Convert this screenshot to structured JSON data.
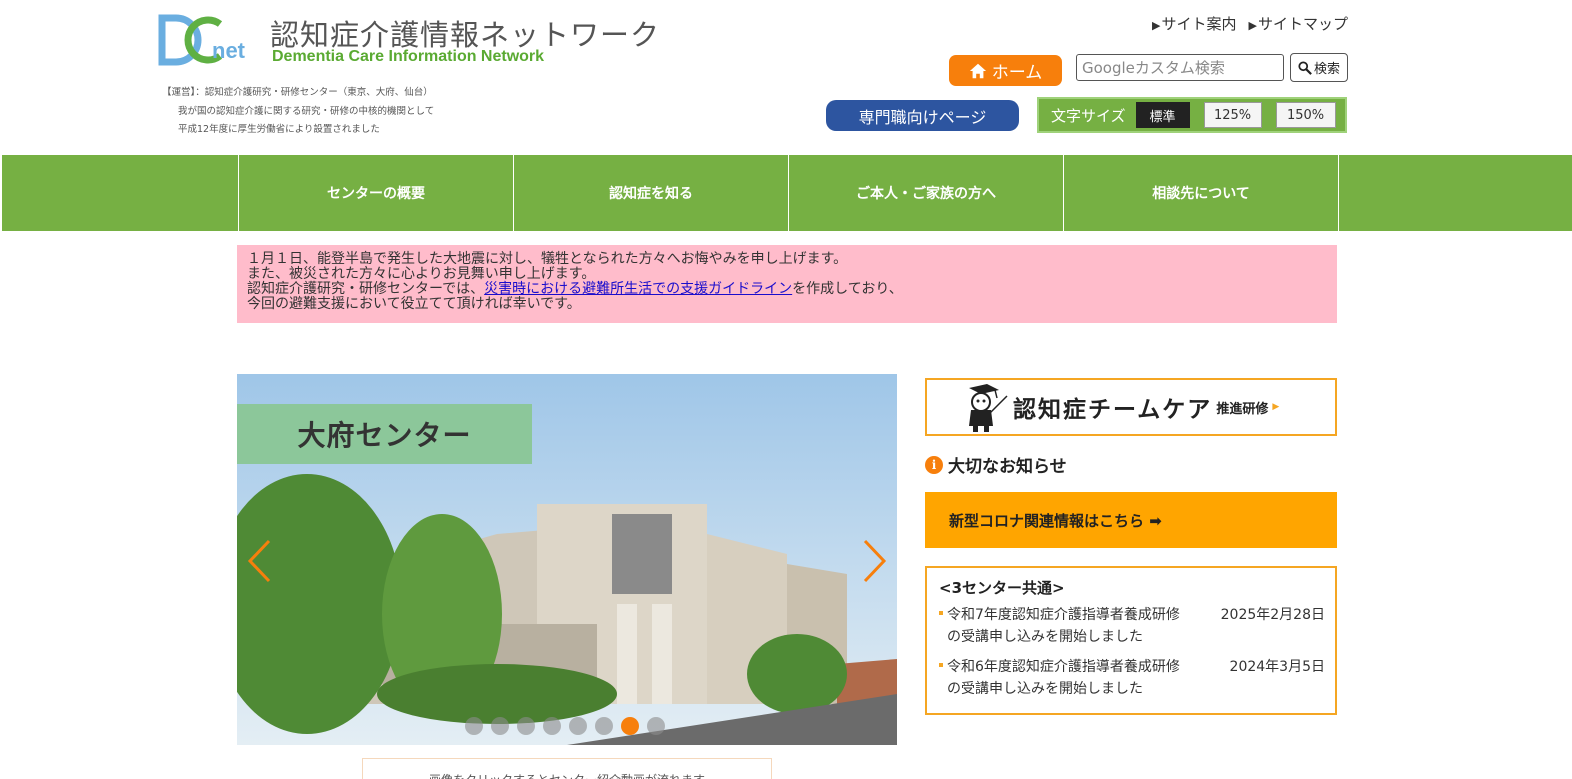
{
  "header": {
    "site_title": "認知症介護情報ネットワーク",
    "site_subtitle": "Dementia Care Information Network",
    "about_lines": [
      "【運営】：認知症介護研究・研修センター（東京、大府、仙台）",
      "我が国の認知症介護に関する研究・研修の中核的機関として",
      "平成12年度に厚生労働省により設置されました"
    ],
    "links": {
      "site_guide": "サイト案内",
      "site_map": "サイトマップ"
    },
    "home_label": "ホーム",
    "search": {
      "placeholder": "Googleカスタム検索",
      "button_label": "検索"
    },
    "pro_page_label": "専門職向けページ",
    "font_size": {
      "label": "文字サイズ",
      "options": [
        "標準",
        "125%",
        "150%"
      ],
      "selected": "標準"
    }
  },
  "nav": {
    "items": [
      "センターの概要",
      "認知症を知る",
      "ご本人・ご家族の方へ",
      "相談先について"
    ]
  },
  "notice": {
    "line1": "１月１日、能登半島で発生した大地震に対し、犠牲となられた方々へお悔やみを申し上げます。",
    "line2": "また、被災された方々に心よりお見舞い申し上げます。",
    "line3_prefix": "認知症介護研究・研修センターでは、",
    "line3_link": "災害時における避難所生活での支援ガイドライン",
    "line3_suffix": "を作成しており、",
    "line4": "今回の避難支援において役立てて頂ければ幸いです。"
  },
  "slider": {
    "label": "大府センター",
    "total_slides": 8,
    "active_slide": 7,
    "caption": "画像をクリックするとセンター紹介動画が流れます"
  },
  "sidebar": {
    "teamcare_title": "認知症チームケア",
    "teamcare_suffix": "推進研修",
    "important_heading": "大切なお知らせ",
    "important_icon": "i",
    "corona_label": "新型コロナ関連情報はこちら ➡",
    "news": {
      "heading": "<3センター共通>",
      "items": [
        {
          "title": "令和7年度認知症介護指導者養成研修の受講申し込みを開始しました",
          "date": "2025年2月28日"
        },
        {
          "title": "令和6年度認知症介護指導者養成研修の受講申し込みを開始しました",
          "date": "2024年3月5日"
        }
      ]
    }
  },
  "colors": {
    "nav_green": "#76b043",
    "home_orange": "#f77f0c",
    "pro_blue": "#2d55a0",
    "notice_pink": "#ffbccb",
    "corona_orange": "#ffa500"
  }
}
